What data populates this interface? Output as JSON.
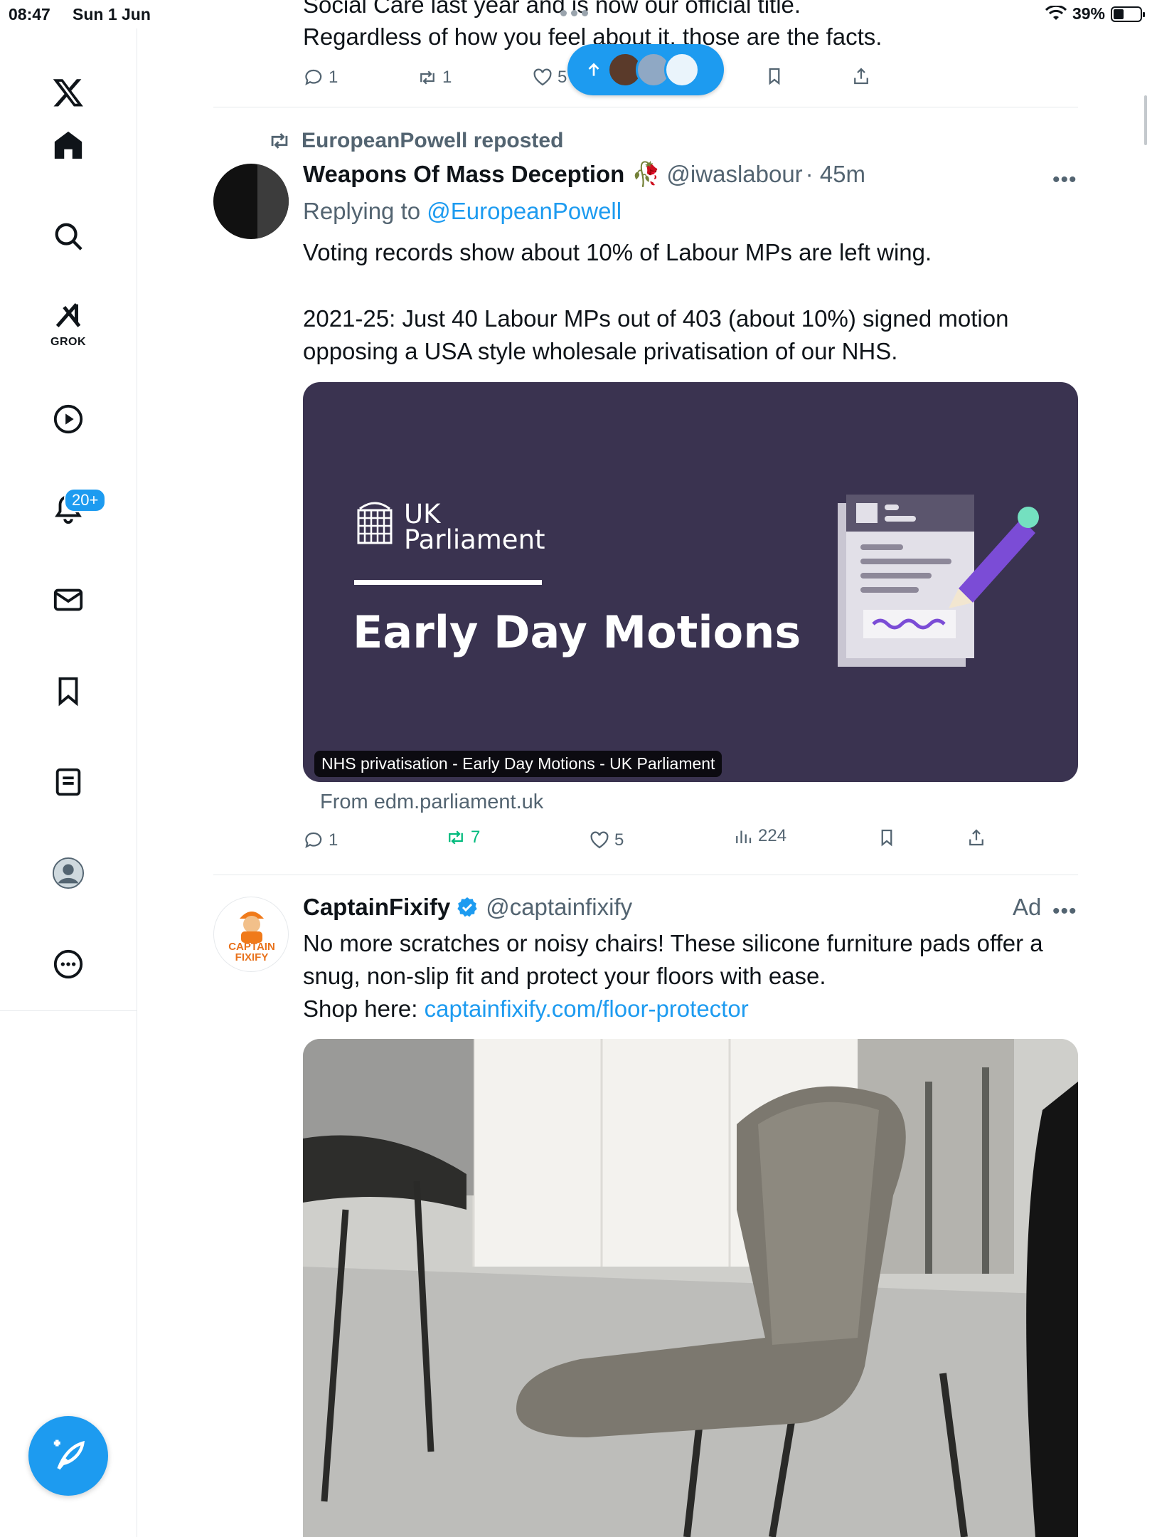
{
  "status_bar": {
    "time": "08:47",
    "date": "Sun 1 Jun",
    "battery": "39%"
  },
  "sidebar": {
    "items": [
      {
        "name": "home",
        "icon": "home-icon"
      },
      {
        "name": "explore",
        "icon": "search-icon"
      },
      {
        "name": "grok",
        "icon": "grok-icon",
        "label": "GROK"
      },
      {
        "name": "video",
        "icon": "play-icon"
      },
      {
        "name": "notifications",
        "icon": "bell-icon",
        "badge": "20+"
      },
      {
        "name": "messages",
        "icon": "mail-icon"
      },
      {
        "name": "bookmarks",
        "icon": "bookmark-icon"
      },
      {
        "name": "lists",
        "icon": "list-icon"
      },
      {
        "name": "profile",
        "icon": "profile-icon"
      },
      {
        "name": "more",
        "icon": "more-icon"
      }
    ]
  },
  "prev_tweet": {
    "line1": "Social Care last year and is now our official title.",
    "line2": "Regardless of how you feel about it, those are the facts.",
    "replies": "1",
    "reposts": "1",
    "likes": "5"
  },
  "tweet": {
    "repost_by": "EuropeanPowell reposted",
    "display_name": "Weapons Of Mass Deception",
    "emoji": "🥀",
    "handle": "@iwaslabour",
    "time": "· 45m",
    "replying_prefix": "Replying to ",
    "replying_to": "@EuropeanPowell",
    "body_line1": "Voting records show about 10% of Labour MPs are left wing.",
    "body_line2": "2021-25: Just 40 Labour MPs out of 403 (about 10%) signed motion",
    "body_line3": "opposing a USA style wholesale privatisation of our NHS.",
    "card": {
      "brand_line1": "UK",
      "brand_line2": "Parliament",
      "heading": "Early Day Motions",
      "caption": "NHS privatisation - Early Day Motions - UK Parliament",
      "source": "From edm.parliament.uk"
    },
    "replies": "1",
    "reposts": "7",
    "likes": "5",
    "views": "224"
  },
  "ad": {
    "display_name": "CaptainFixify",
    "handle": "@captainfixify",
    "ad_label": "Ad",
    "logo_text": "CAPTAIN FIXIFY",
    "body_line1": "No more scratches or noisy chairs! These silicone furniture pads offer a",
    "body_line2": "snug, non-slip fit and protect your floors with ease.",
    "shop_prefix": "Shop here: ",
    "shop_link": "captainfixify.com/floor-protector"
  },
  "colors": {
    "accent": "#1d9bf0",
    "repost_green": "#00ba7c",
    "card_bg": "#3a3350"
  }
}
